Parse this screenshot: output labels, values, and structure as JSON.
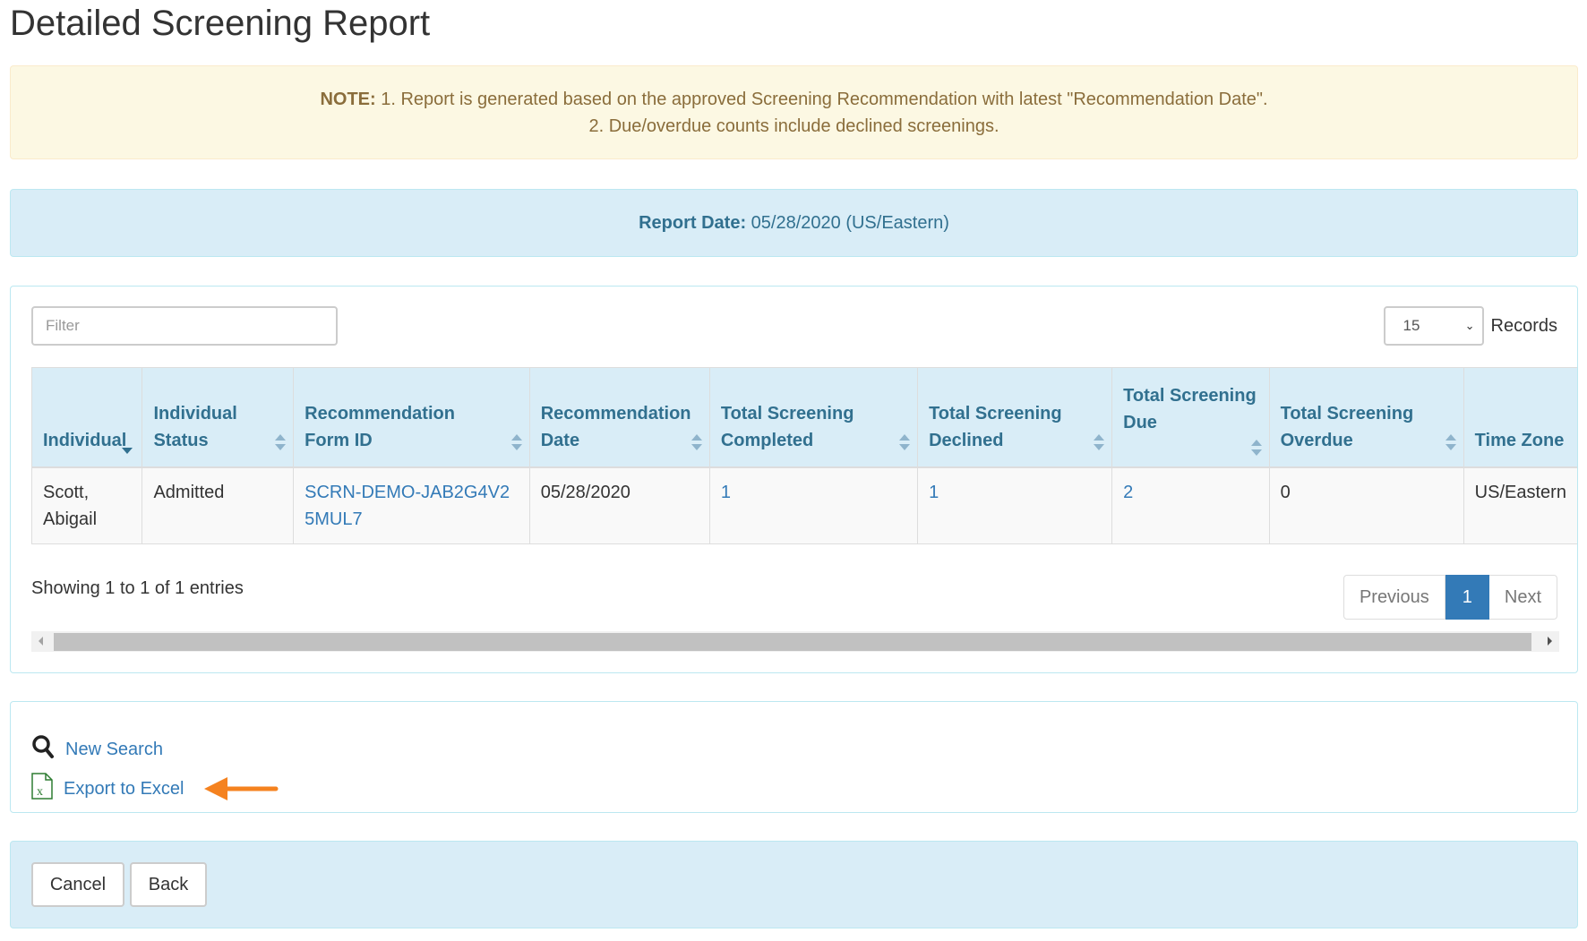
{
  "page": {
    "title": "Detailed Screening Report"
  },
  "note": {
    "label": "NOTE:",
    "line1": " 1. Report is generated based on the approved Screening Recommendation with latest \"Recommendation Date\".",
    "line2": "2. Due/overdue counts include declined screenings."
  },
  "report_date": {
    "label": "Report Date:",
    "value": " 05/28/2020 (US/Eastern)"
  },
  "table_controls": {
    "filter_placeholder": "Filter",
    "filter_value": "",
    "records_selected": "15",
    "records_label": "Records"
  },
  "table": {
    "columns": [
      {
        "label": "Individual",
        "sort": "desc"
      },
      {
        "label": "Individual Status",
        "sort": "both"
      },
      {
        "label": "Recommendation Form ID",
        "sort": "both"
      },
      {
        "label": "Recommendation Date",
        "sort": "both"
      },
      {
        "label": "Total Screening Completed",
        "sort": "both"
      },
      {
        "label": "Total Screening Declined",
        "sort": "both"
      },
      {
        "label": "Total Screening Due",
        "sort": "both"
      },
      {
        "label": "Total Screening Overdue",
        "sort": "both"
      },
      {
        "label": "Time Zone",
        "sort": "none"
      }
    ],
    "rows": [
      {
        "individual": "Scott, Abigail",
        "status": "Admitted",
        "form_id": "SCRN-DEMO-JAB2G4V25MUL7",
        "date": "05/28/2020",
        "completed": "1",
        "declined": "1",
        "due": "2",
        "overdue": "0",
        "time_zone": "US/Eastern"
      }
    ]
  },
  "pagination": {
    "summary": "Showing 1 to 1 of 1 entries",
    "previous": "Previous",
    "current_page": "1",
    "next": "Next"
  },
  "actions": {
    "new_search": {
      "label": "New Search",
      "icon": "search-icon"
    },
    "export_excel": {
      "label": "Export to Excel",
      "icon": "excel-file-icon"
    },
    "annotation_arrow_color": "#f5821f"
  },
  "footer": {
    "cancel": "Cancel",
    "back": "Back"
  },
  "colors": {
    "link": "#337ab7",
    "info_bg": "#d9edf7",
    "info_text": "#31708f",
    "warning_bg": "#fcf8e3",
    "warning_text": "#8a6d3b",
    "active_page": "#337ab7"
  }
}
